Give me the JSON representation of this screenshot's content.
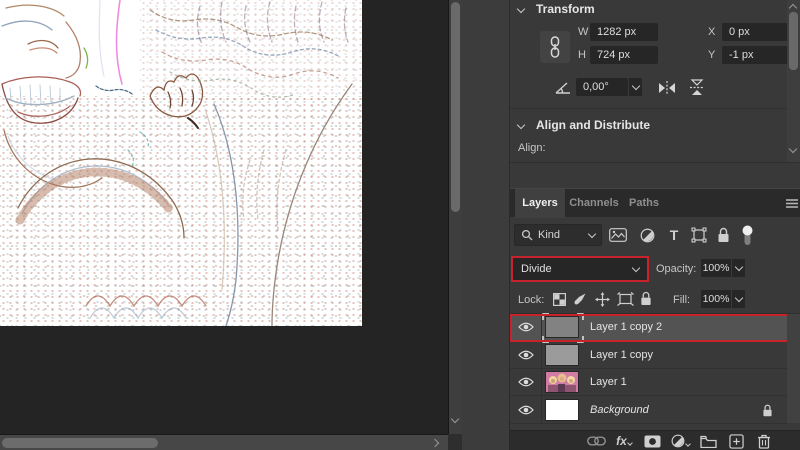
{
  "colors": {
    "highlight_red": "#c8232c",
    "panel_bg": "#393939",
    "canvas_pasteboard": "#242424",
    "selected_row": "#535353"
  },
  "properties_panel": {
    "transform": {
      "title": "Transform",
      "w_label": "W",
      "w_value": "1282 px",
      "x_label": "X",
      "x_value": "0 px",
      "h_label": "H",
      "h_value": "724 px",
      "y_label": "Y",
      "y_value": "-1 px",
      "angle_value": "0,00°"
    },
    "align": {
      "title": "Align and Distribute",
      "align_label": "Align:"
    }
  },
  "layers_panel": {
    "tabs": {
      "layers": "Layers",
      "channels": "Channels",
      "paths": "Paths"
    },
    "filter": {
      "kind_label": "Kind",
      "type_letter": "T"
    },
    "blend": {
      "mode": "Divide",
      "opacity_label": "Opacity:",
      "opacity_value": "100%"
    },
    "lock": {
      "label": "Lock:",
      "fill_label": "Fill:",
      "fill_value": "100%"
    },
    "layers": [
      {
        "name": "Layer 1 copy 2",
        "selected": true
      },
      {
        "name": "Layer 1 copy"
      },
      {
        "name": "Layer 1"
      },
      {
        "name": "Background",
        "locked": true
      }
    ],
    "footer": {
      "fx_label": "fx"
    }
  },
  "icons": {
    "panel_menu": "hamburger",
    "kind_search": "magnifier",
    "visibility": "eye",
    "background_lock": "padlock"
  }
}
